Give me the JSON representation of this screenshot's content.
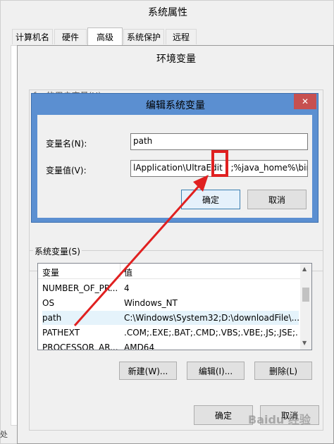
{
  "outer_window": {
    "title": "系统属性",
    "tabs": [
      {
        "label": "计算机名"
      },
      {
        "label": "硬件"
      },
      {
        "label": "高级"
      },
      {
        "label": "系统保护"
      },
      {
        "label": "远程"
      }
    ]
  },
  "env_window": {
    "title": "环境变量",
    "user_section_label": "f... 的用户变量(U)",
    "system_section_label": "系统变量(S)",
    "table": {
      "columns": [
        "变量",
        "值"
      ],
      "rows": [
        {
          "name": "NUMBER_OF_PR...",
          "value": "4"
        },
        {
          "name": "OS",
          "value": "Windows_NT"
        },
        {
          "name": "path",
          "value": "C:\\Windows\\System32;D:\\downloadFile\\..."
        },
        {
          "name": "PATHEXT",
          "value": ".COM;.EXE;.BAT;.CMD;.VBS;.VBE;.JS;.JSE;..."
        },
        {
          "name": "PROCESSOR_AR...",
          "value": "AMD64"
        }
      ]
    },
    "buttons": {
      "new": "新建(W)...",
      "edit": "编辑(I)...",
      "delete": "删除(L)"
    },
    "ok": "确定",
    "cancel": "取消"
  },
  "edit_dialog": {
    "title": "编辑系统变量",
    "close_symbol": "✕",
    "name_label": "变量名(N):",
    "name_value": "path",
    "value_label": "变量值(V):",
    "value_text": "lApplication\\UltraEdit ; ;%java_home%\\bin;",
    "ok": "确定",
    "cancel": "取消"
  },
  "colors": {
    "dialog_title_bar": "#5b8fd1",
    "highlight": "#e02020"
  },
  "watermark": {
    "text": "Baidu 经验"
  },
  "left_edge_text": "处"
}
